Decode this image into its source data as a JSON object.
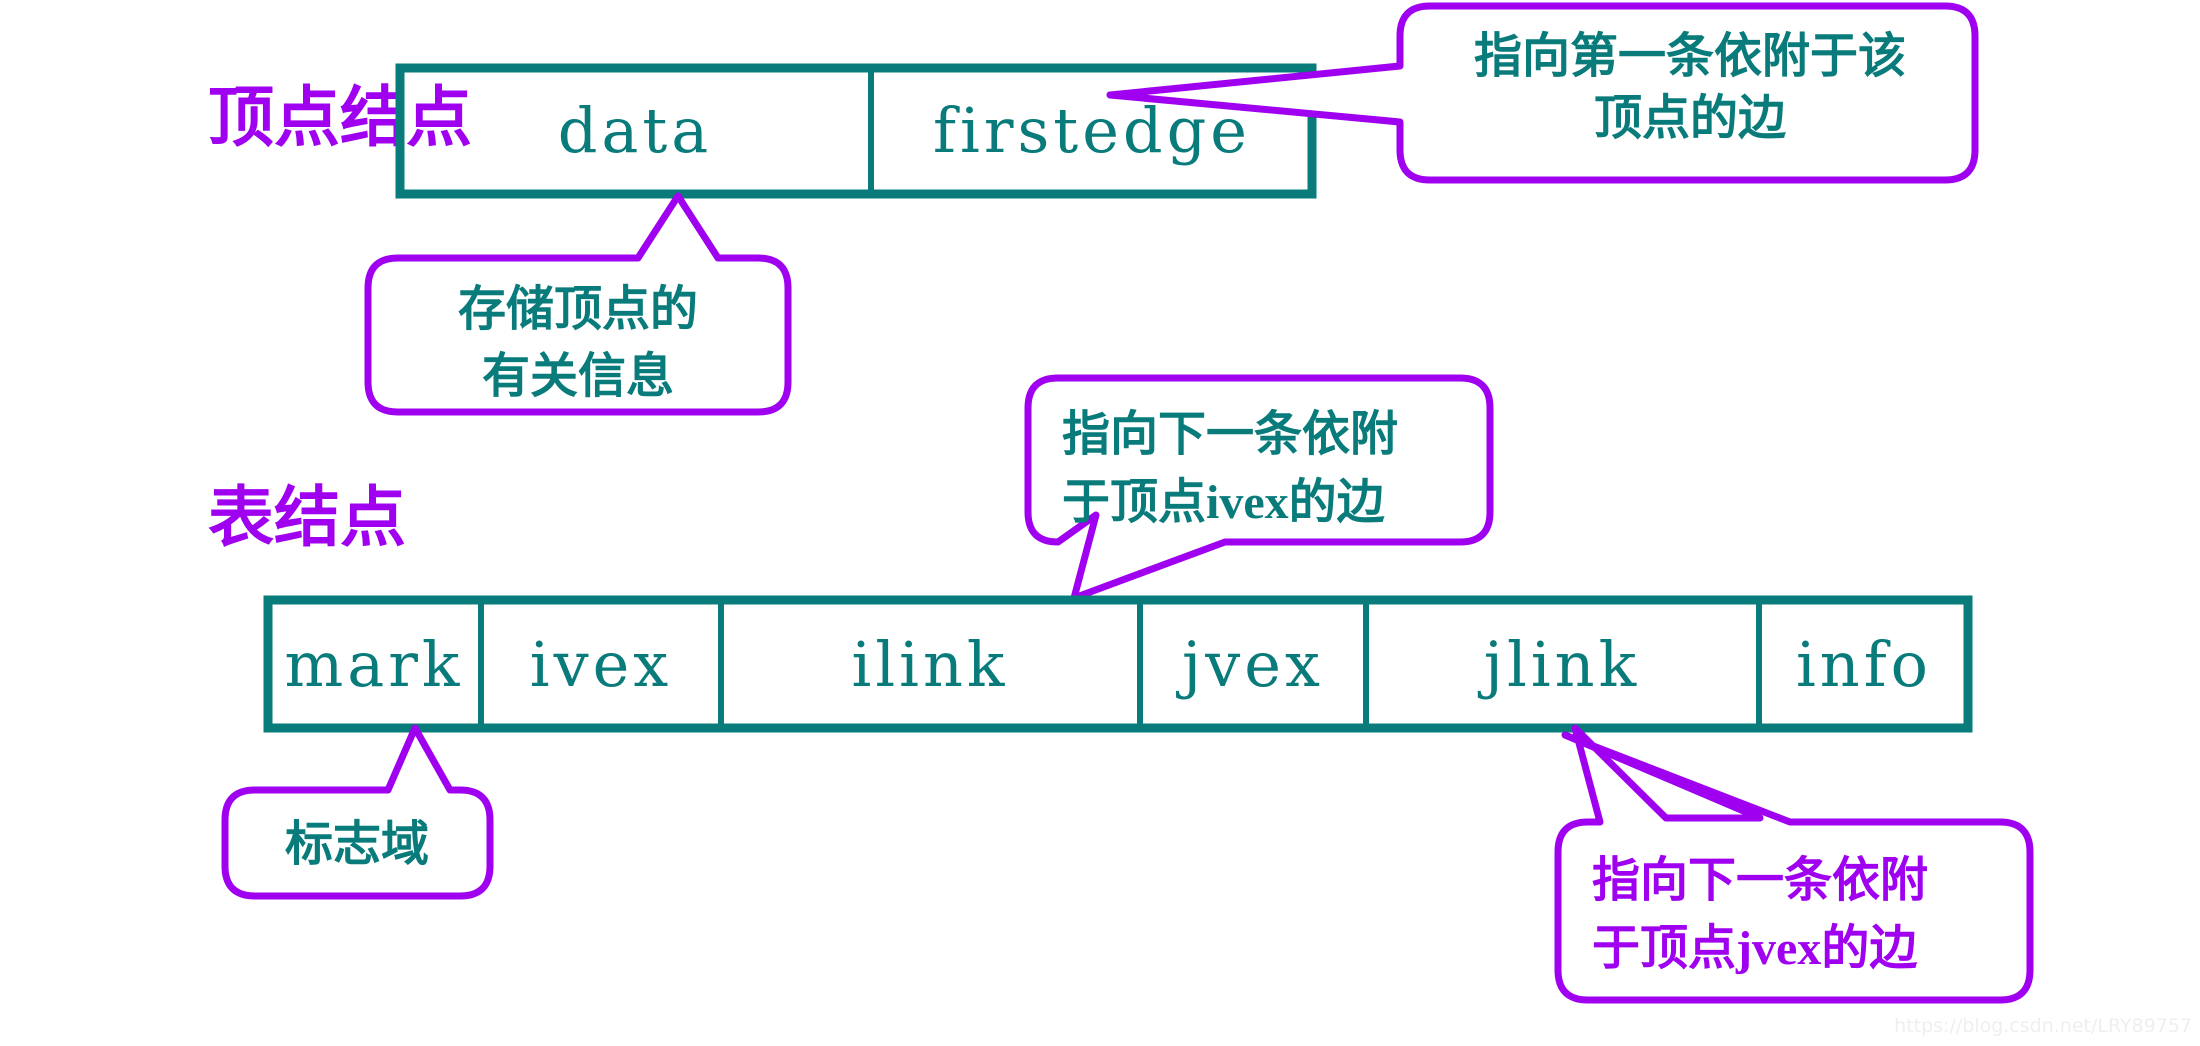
{
  "theme": {
    "struct_color": "#0a7b7b",
    "accent_color": "#a000f0",
    "background": "#ffffff",
    "watermark_color": "#efefef"
  },
  "labels": {
    "vertex_node": "顶点结点",
    "table_node": "表结点"
  },
  "vertex_node": {
    "fields": [
      {
        "name": "data",
        "label": "data"
      },
      {
        "name": "firstedge",
        "label": "firstedge"
      }
    ]
  },
  "table_node": {
    "fields": [
      {
        "name": "mark",
        "label": "mark"
      },
      {
        "name": "ivex",
        "label": "ivex"
      },
      {
        "name": "ilink",
        "label": "ilink"
      },
      {
        "name": "jvex",
        "label": "jvex"
      },
      {
        "name": "jlink",
        "label": "jlink"
      },
      {
        "name": "info",
        "label": "info"
      }
    ]
  },
  "callouts": [
    {
      "id": "firstedge-note",
      "target": "firstedge",
      "text_color": "#0a7b7b",
      "lines": [
        {
          "parts": [
            {
              "text": "指向第一条依附于该",
              "bold_latin": false
            }
          ]
        },
        {
          "parts": [
            {
              "text": "顶点的边",
              "bold_latin": false
            }
          ]
        }
      ]
    },
    {
      "id": "data-note",
      "target": "data",
      "text_color": "#0a7b7b",
      "lines": [
        {
          "parts": [
            {
              "text": "存储顶点的",
              "bold_latin": false
            }
          ]
        },
        {
          "parts": [
            {
              "text": "有关信息",
              "bold_latin": false
            }
          ]
        }
      ]
    },
    {
      "id": "ilink-note",
      "target": "ilink",
      "text_color": "#0a7b7b",
      "lines": [
        {
          "parts": [
            {
              "text": "指向下一条依附",
              "bold_latin": false
            }
          ]
        },
        {
          "parts": [
            {
              "text": "于顶点",
              "bold_latin": false
            },
            {
              "text": "ivex",
              "bold_latin": true
            },
            {
              "text": "的边",
              "bold_latin": false
            }
          ]
        }
      ]
    },
    {
      "id": "mark-note",
      "target": "mark",
      "text_color": "#0a7b7b",
      "lines": [
        {
          "parts": [
            {
              "text": "标志域",
              "bold_latin": false
            }
          ]
        }
      ]
    },
    {
      "id": "jlink-note",
      "target": "jlink",
      "text_color": "#a000f0",
      "lines": [
        {
          "parts": [
            {
              "text": "指向下一条依附",
              "bold_latin": false
            }
          ]
        },
        {
          "parts": [
            {
              "text": "于顶点",
              "bold_latin": false
            },
            {
              "text": "jvex",
              "bold_latin": true
            },
            {
              "text": "的边",
              "bold_latin": false
            }
          ]
        }
      ]
    }
  ],
  "watermark": {
    "text": "https://blog.csdn.net/LRY89757"
  }
}
